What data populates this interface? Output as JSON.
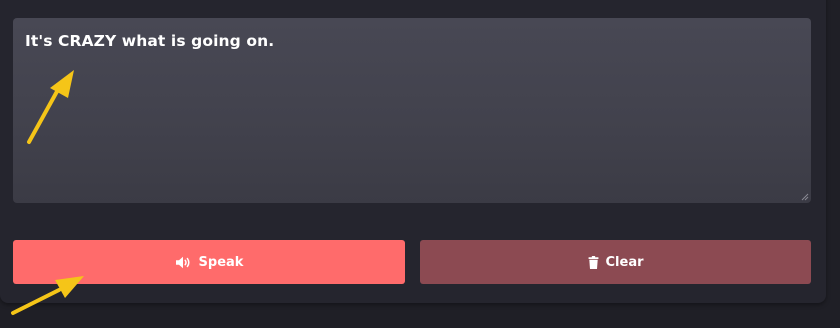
{
  "textarea": {
    "value": "It's CRAZY what is going on."
  },
  "buttons": {
    "speak_label": "Speak",
    "speak_icon": "volume-icon",
    "clear_label": "Clear",
    "clear_icon": "trash-icon"
  },
  "colors": {
    "page_background": "#1f1f26",
    "panel_background": "#25252e",
    "textarea_background": "#42424d",
    "speak_button": "#ff6b6b",
    "clear_button": "#8c4a52",
    "annotation_arrow": "#f5c518"
  },
  "annotations": [
    "arrow-pointing-to-text",
    "arrow-pointing-to-speak-button"
  ]
}
